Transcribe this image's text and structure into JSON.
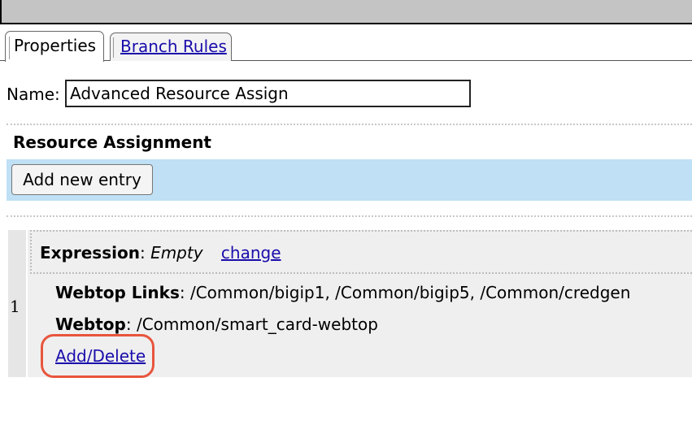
{
  "tabs": [
    {
      "label": "Properties",
      "active": true
    },
    {
      "label": "Branch Rules",
      "active": false
    }
  ],
  "name_field": {
    "label": "Name:",
    "value": "Advanced Resource Assign"
  },
  "section": {
    "title": "Resource Assignment",
    "add_button_label": "Add new entry"
  },
  "entries": [
    {
      "index": "1",
      "expression_label": "Expression",
      "expression_sep": ":",
      "expression_value": "Empty",
      "change_link": "change",
      "webtop_links_label": "Webtop Links",
      "webtop_links_sep": ":",
      "webtop_links_value": "/Common/bigip1, /Common/bigip5, /Common/credgen",
      "webtop_label": "Webtop",
      "webtop_sep": ":",
      "webtop_value": "/Common/smart_card-webtop",
      "add_delete_link": "Add/Delete"
    }
  ],
  "colors": {
    "link": "#1a0dab",
    "add_bar_bg": "#bfe0f5",
    "entry_bg": "#efefef",
    "highlight_ring": "#e8553d"
  }
}
